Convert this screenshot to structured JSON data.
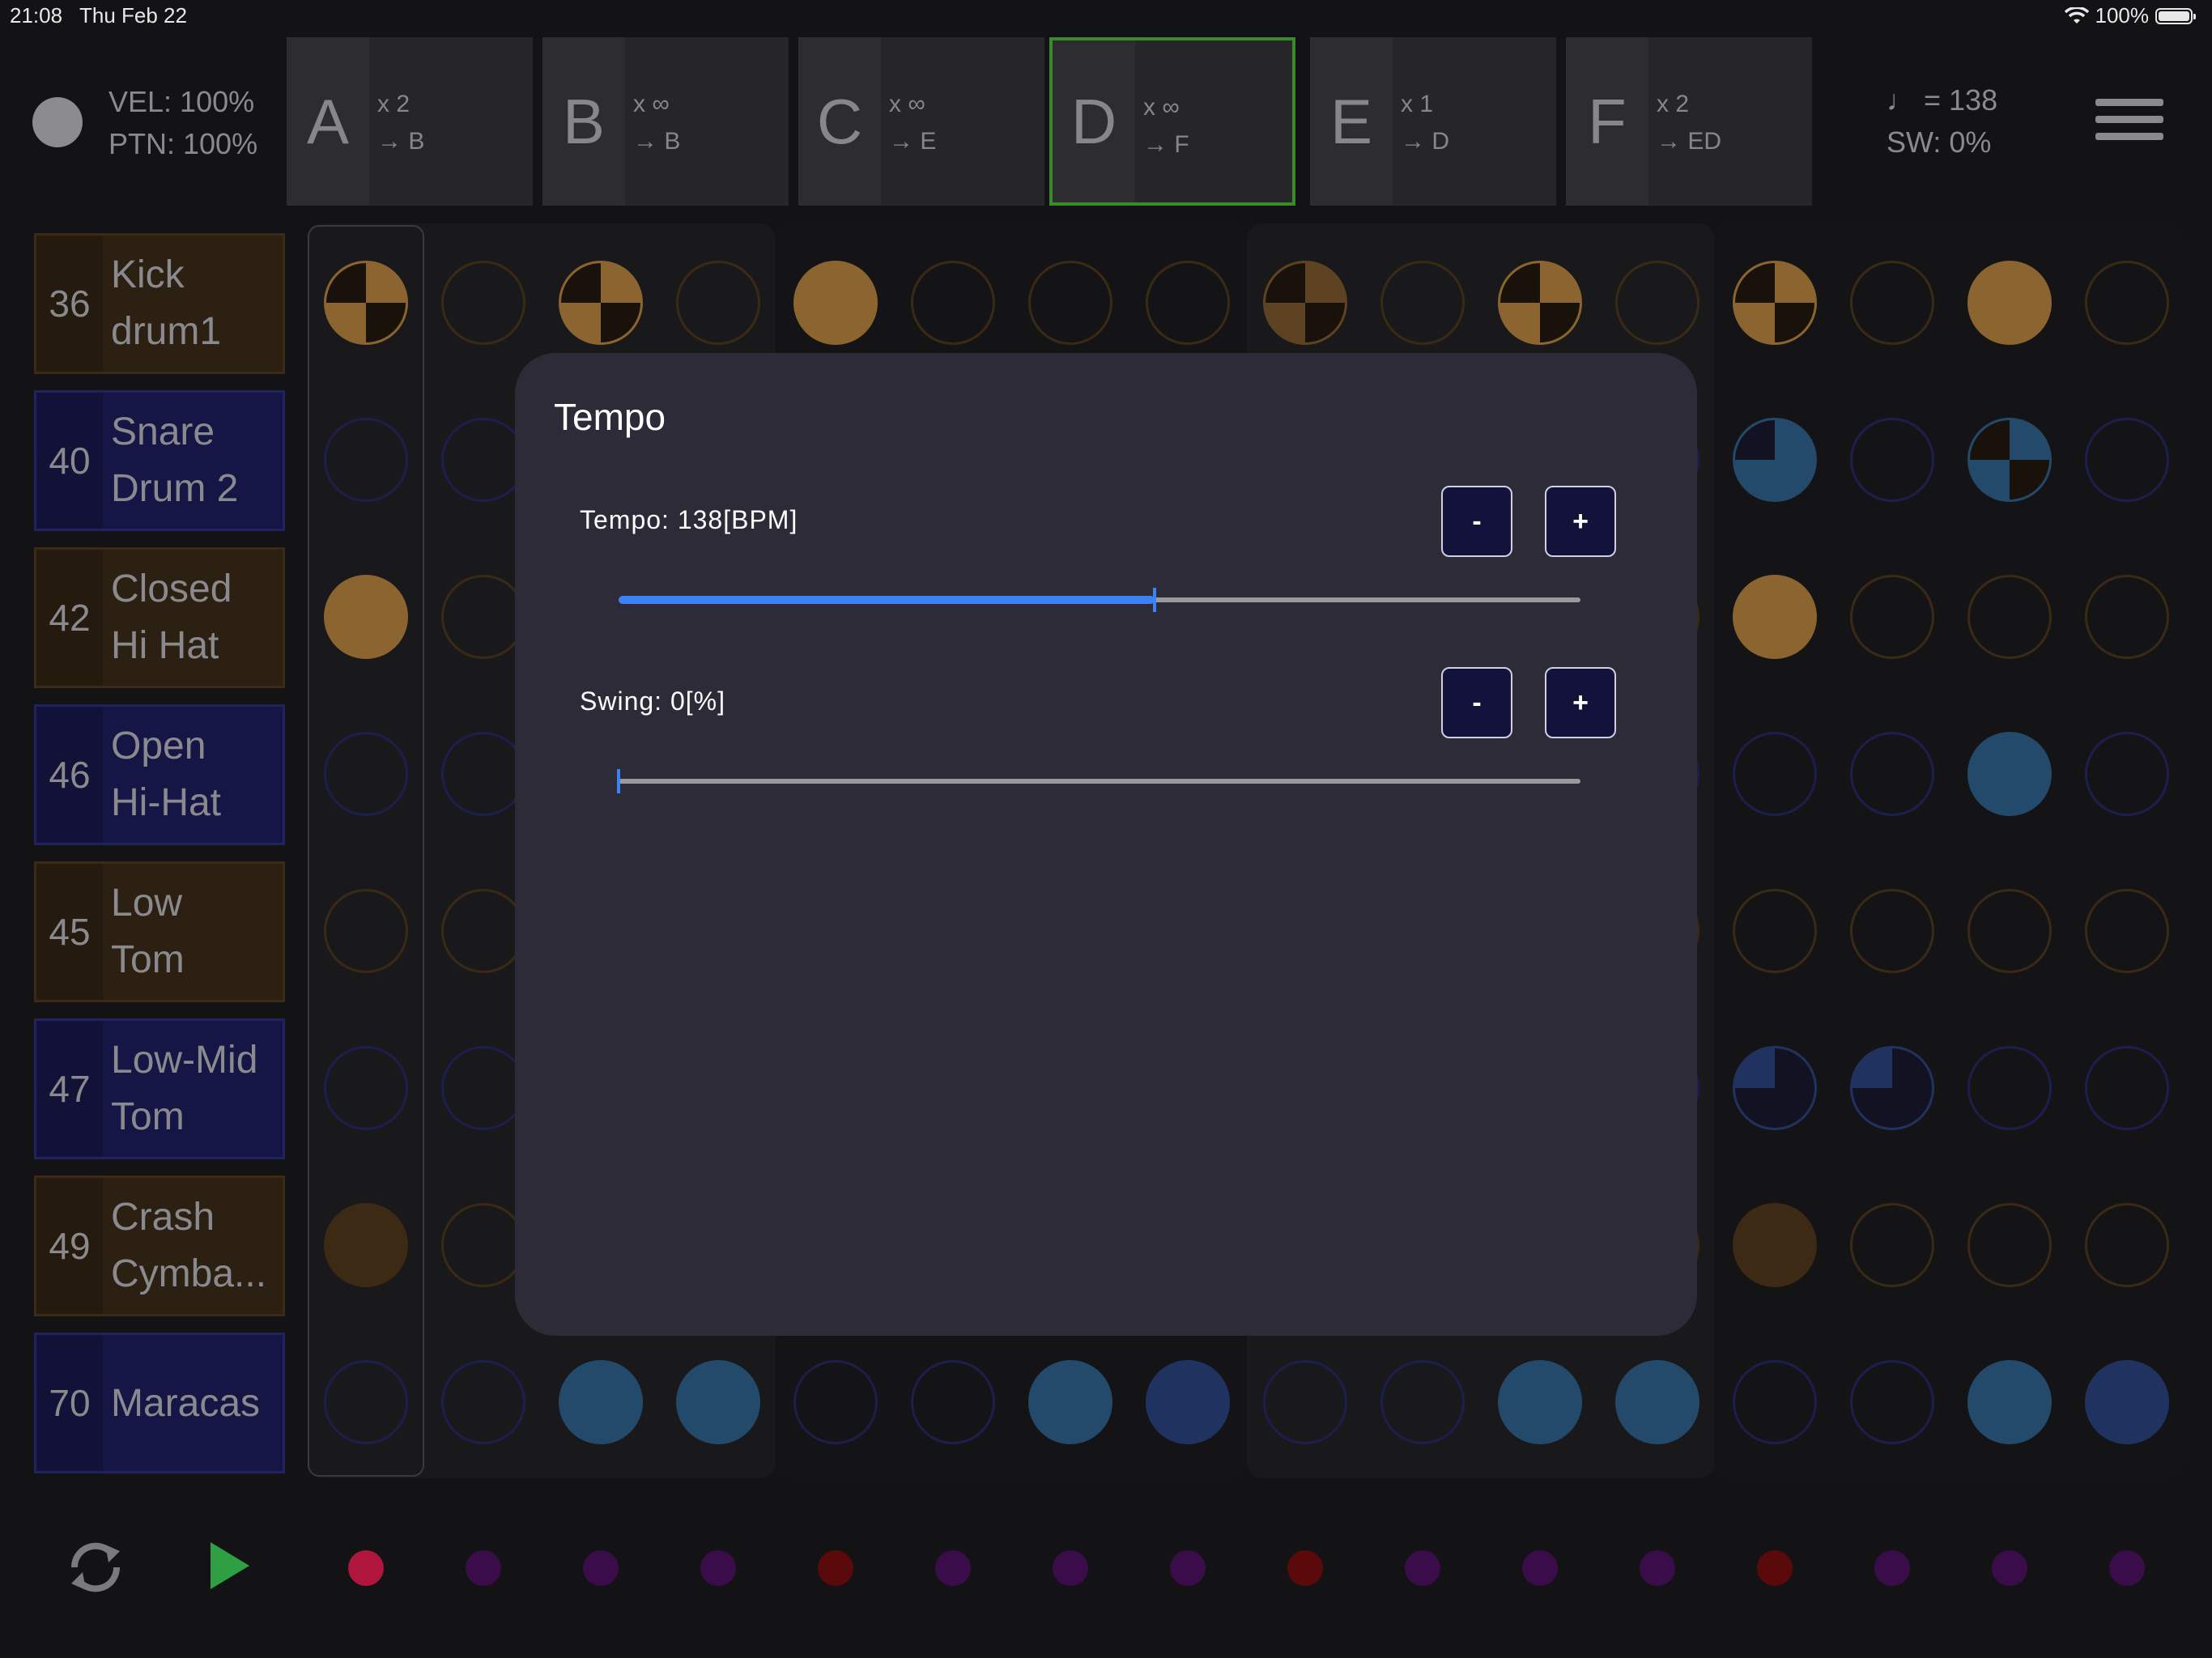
{
  "status_bar": {
    "time": "21:08",
    "date": "Thu Feb 22",
    "battery": "100%"
  },
  "header": {
    "velocity": "VEL: 100%",
    "pattern_level": "PTN: 100%",
    "tempo_note": "♩ = 138",
    "swing": "SW: 0%"
  },
  "patterns": [
    {
      "letter": "A",
      "repeat": "x 2",
      "next": "→ B",
      "selected": false
    },
    {
      "letter": "B",
      "repeat": "x ∞",
      "next": "→ B",
      "selected": false
    },
    {
      "letter": "C",
      "repeat": "x ∞",
      "next": "→ E",
      "selected": false
    },
    {
      "letter": "D",
      "repeat": "x ∞",
      "next": "→ F",
      "selected": true
    },
    {
      "letter": "E",
      "repeat": "x 1",
      "next": "→ D",
      "selected": false
    },
    {
      "letter": "F",
      "repeat": "x 2",
      "next": "→ ED",
      "selected": false
    }
  ],
  "tracks": [
    {
      "note": "36",
      "name_line1": "Kick",
      "name_line2": "drum1"
    },
    {
      "note": "40",
      "name_line1": "Snare",
      "name_line2": "Drum 2"
    },
    {
      "note": "42",
      "name_line1": "Closed",
      "name_line2": "Hi Hat"
    },
    {
      "note": "46",
      "name_line1": "Open",
      "name_line2": "Hi-Hat"
    },
    {
      "note": "45",
      "name_line1": "Low",
      "name_line2": "Tom"
    },
    {
      "note": "47",
      "name_line1": "Low-Mid",
      "name_line2": "Tom"
    },
    {
      "note": "49",
      "name_line1": "Crash",
      "name_line2": "Cymba..."
    },
    {
      "note": "70",
      "name_line1": "Maracas",
      "name_line2": ""
    }
  ],
  "steps": [
    [
      "q2",
      "o",
      "q2",
      "o",
      "f",
      "o",
      "o",
      "o",
      "q2d",
      "o",
      "q2",
      "o",
      "q2",
      "o",
      "f",
      "o"
    ],
    [
      "o",
      "o",
      "o",
      "o",
      "o",
      "o",
      "o",
      "o",
      "o",
      "o",
      "o",
      "o",
      "q3",
      "o",
      "q2",
      "o"
    ],
    [
      "f",
      "o",
      "o",
      "o",
      "o",
      "o",
      "o",
      "o",
      "o",
      "o",
      "o",
      "o",
      "f",
      "o",
      "o",
      "o"
    ],
    [
      "o",
      "o",
      "o",
      "o",
      "o",
      "o",
      "o",
      "o",
      "o",
      "o",
      "o",
      "o",
      "o",
      "o",
      "f",
      "o"
    ],
    [
      "o",
      "o",
      "o",
      "o",
      "o",
      "o",
      "o",
      "o",
      "o",
      "o",
      "o",
      "o",
      "o",
      "o",
      "o",
      "o"
    ],
    [
      "o",
      "o",
      "o",
      "o",
      "o",
      "o",
      "o",
      "o",
      "o",
      "o",
      "o",
      "o",
      "q1",
      "q1",
      "o",
      "o"
    ],
    [
      "d",
      "o",
      "o",
      "o",
      "o",
      "o",
      "o",
      "o",
      "o",
      "o",
      "o",
      "o",
      "d",
      "o",
      "o",
      "o"
    ],
    [
      "o",
      "o",
      "f",
      "f",
      "o",
      "o",
      "f",
      "f2",
      "o",
      "o",
      "f",
      "f",
      "o",
      "o",
      "f",
      "f2"
    ]
  ],
  "colors": {
    "warm_fill": "#8b6430",
    "warm_dim": "#3d2a14",
    "warm_ring": "#3a2a15",
    "cool_fill": "#234a6a",
    "cool_fill2": "#203360",
    "cool_ring": "#1e1e4e",
    "accent_blue": "#3b82f6",
    "selected_border": "#3a8a2c",
    "play_green": "#2ea043"
  },
  "transport_leds": [
    "#b0153d",
    "#3a0c4a",
    "#3a0c4a",
    "#3a0c4a",
    "#5a0a0a",
    "#3a0c4a",
    "#3a0c4a",
    "#3a0c4a",
    "#5a0a0a",
    "#3a0c4a",
    "#3a0c4a",
    "#3a0c4a",
    "#5a0a0a",
    "#3a0c4a",
    "#3a0c4a",
    "#3a0c4a"
  ],
  "dialog": {
    "title": "Tempo",
    "tempo_label": "Tempo: 138[BPM]",
    "tempo_fraction": 0.557,
    "swing_label": "Swing: 0[%]",
    "swing_fraction": 0,
    "minus": "-",
    "plus": "+"
  },
  "icons": {
    "menu": "hamburger-icon",
    "loop": "loop-icon",
    "play": "play-icon",
    "wifi": "wifi-icon",
    "battery": "battery-icon"
  }
}
